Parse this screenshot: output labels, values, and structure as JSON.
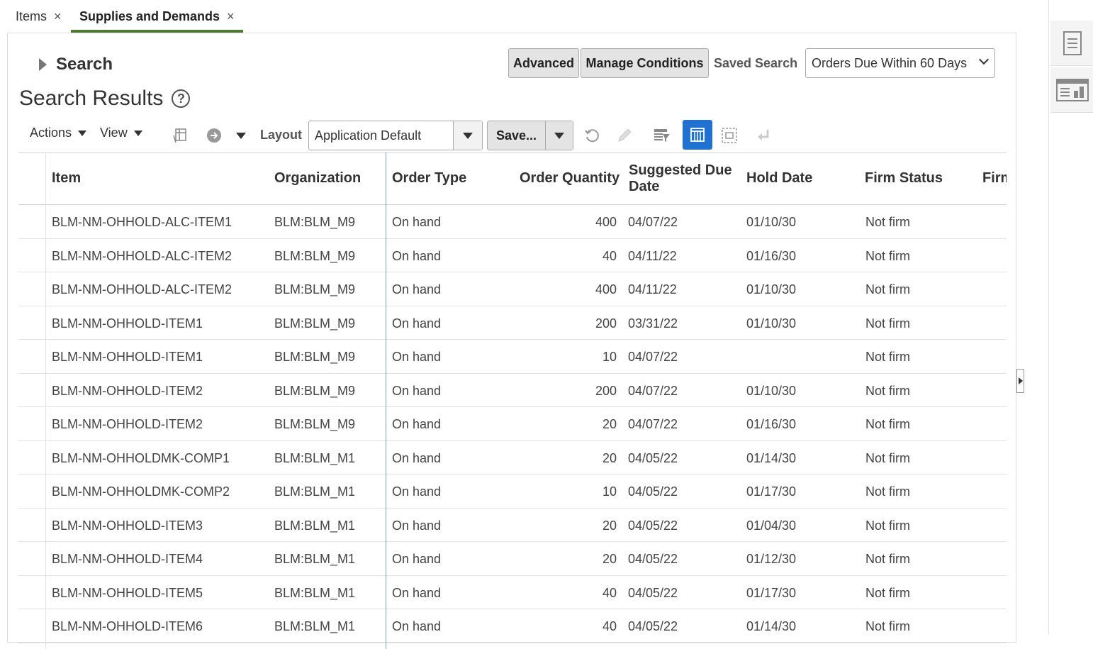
{
  "tabs": [
    {
      "label": "Items",
      "close": "×"
    },
    {
      "label": "Supplies and Demands",
      "close": "×"
    }
  ],
  "search": {
    "title": "Search",
    "advanced_label": "Advanced",
    "manage_conditions_label": "Manage Conditions",
    "saved_search_label": "Saved Search",
    "saved_search_value": "Orders Due Within 60 Days"
  },
  "results": {
    "title": "Search Results",
    "help": "?"
  },
  "toolbar": {
    "actions_label": "Actions",
    "view_label": "View",
    "layout_label": "Layout",
    "layout_value": "Application Default",
    "save_label": "Save..."
  },
  "table": {
    "headers": {
      "item": "Item",
      "organization": "Organization",
      "order_type": "Order Type",
      "order_quantity": "Order Quantity",
      "suggested_due_date_1": "Suggested Due",
      "suggested_due_date_2": "Date",
      "hold_date": "Hold Date",
      "firm_status": "Firm Status",
      "firm_cut": "Firm"
    },
    "rows": [
      {
        "item": "BLM-NM-OHHOLD-ALC-ITEM1",
        "org": "BLM:BLM_M9",
        "type": "On hand",
        "qty": "400",
        "due": "04/07/22",
        "hold": "01/10/30",
        "firm": "Not firm"
      },
      {
        "item": "BLM-NM-OHHOLD-ALC-ITEM2",
        "org": "BLM:BLM_M9",
        "type": "On hand",
        "qty": "40",
        "due": "04/11/22",
        "hold": "01/16/30",
        "firm": "Not firm"
      },
      {
        "item": "BLM-NM-OHHOLD-ALC-ITEM2",
        "org": "BLM:BLM_M9",
        "type": "On hand",
        "qty": "400",
        "due": "04/11/22",
        "hold": "01/10/30",
        "firm": "Not firm"
      },
      {
        "item": "BLM-NM-OHHOLD-ITEM1",
        "org": "BLM:BLM_M9",
        "type": "On hand",
        "qty": "200",
        "due": "03/31/22",
        "hold": "01/10/30",
        "firm": "Not firm"
      },
      {
        "item": "BLM-NM-OHHOLD-ITEM1",
        "org": "BLM:BLM_M9",
        "type": "On hand",
        "qty": "10",
        "due": "04/07/22",
        "hold": "",
        "firm": "Not firm"
      },
      {
        "item": "BLM-NM-OHHOLD-ITEM2",
        "org": "BLM:BLM_M9",
        "type": "On hand",
        "qty": "200",
        "due": "04/07/22",
        "hold": "01/10/30",
        "firm": "Not firm"
      },
      {
        "item": "BLM-NM-OHHOLD-ITEM2",
        "org": "BLM:BLM_M9",
        "type": "On hand",
        "qty": "20",
        "due": "04/07/22",
        "hold": "01/16/30",
        "firm": "Not firm"
      },
      {
        "item": "BLM-NM-OHHOLDMK-COMP1",
        "org": "BLM:BLM_M1",
        "type": "On hand",
        "qty": "20",
        "due": "04/05/22",
        "hold": "01/14/30",
        "firm": "Not firm"
      },
      {
        "item": "BLM-NM-OHHOLDMK-COMP2",
        "org": "BLM:BLM_M1",
        "type": "On hand",
        "qty": "10",
        "due": "04/05/22",
        "hold": "01/17/30",
        "firm": "Not firm"
      },
      {
        "item": "BLM-NM-OHHOLD-ITEM3",
        "org": "BLM:BLM_M1",
        "type": "On hand",
        "qty": "20",
        "due": "04/05/22",
        "hold": "01/04/30",
        "firm": "Not firm"
      },
      {
        "item": "BLM-NM-OHHOLD-ITEM4",
        "org": "BLM:BLM_M1",
        "type": "On hand",
        "qty": "20",
        "due": "04/05/22",
        "hold": "01/12/30",
        "firm": "Not firm"
      },
      {
        "item": "BLM-NM-OHHOLD-ITEM5",
        "org": "BLM:BLM_M1",
        "type": "On hand",
        "qty": "40",
        "due": "04/05/22",
        "hold": "01/17/30",
        "firm": "Not firm"
      },
      {
        "item": "BLM-NM-OHHOLD-ITEM6",
        "org": "BLM:BLM_M1",
        "type": "On hand",
        "qty": "40",
        "due": "04/05/22",
        "hold": "01/14/30",
        "firm": "Not firm"
      }
    ]
  }
}
